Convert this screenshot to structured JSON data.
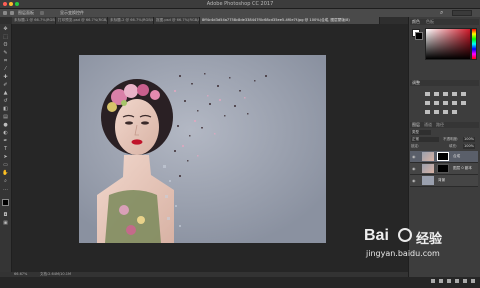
{
  "app": {
    "title": "Adobe Photoshop CC 2017"
  },
  "options_bar": {
    "items": [
      "图层面板",
      "参考点",
      "显示变换控件"
    ]
  },
  "tabs": [
    {
      "label": "未标题-1 @ 66.7%(RGB/8)"
    },
    {
      "label": "打印预览.psd @ 66.7%(RGB/8)"
    },
    {
      "label": "未标题-2 @ 66.7%(RGB/8)"
    },
    {
      "label": "抠图.psd @ 66.7%(RGB/8)"
    },
    {
      "label": "8ff4c4d3d54a7758c8de338447f0c68cd35ee5-4f0e7f.jpg @ 100%(合成, 图层蒙版/8)"
    }
  ],
  "status": {
    "zoom": "66.67%",
    "doc": "文档:2.64M/10.1M"
  },
  "panels": {
    "color": {
      "tab_color": "颜色",
      "tab_swatches": "色板"
    },
    "adjust": {
      "tab": "调整"
    },
    "layers": {
      "tabs": [
        "图层",
        "通道",
        "路径"
      ],
      "kind": "类型",
      "blend": "正常",
      "opacity_label": "不透明度:",
      "opacity": "100%",
      "lock_label": "锁定:",
      "fill_label": "填充:",
      "fill": "100%",
      "items": [
        {
          "name": "合成"
        },
        {
          "name": "图层 0 副本"
        },
        {
          "name": "背景"
        }
      ]
    }
  },
  "watermark": {
    "brand": "Bai",
    "brand2": "经验",
    "url": "jingyan.baidu.com"
  },
  "colors": {
    "accent": "#d01a2a",
    "bg": "#262626",
    "panel": "#3d3d3d"
  }
}
